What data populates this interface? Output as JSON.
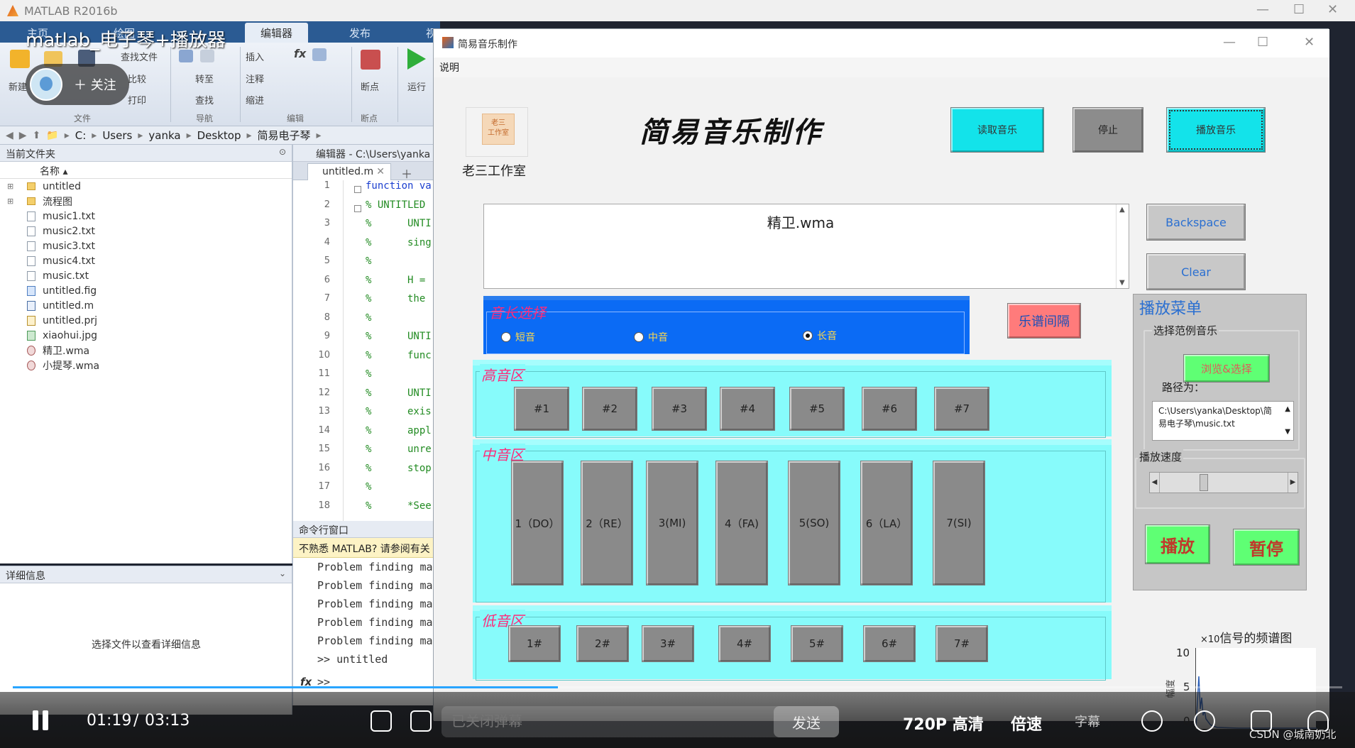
{
  "matlab": {
    "window_title": "MATLAB R2016b",
    "ribbon_tabs": [
      "主页",
      "绘图",
      "编辑器",
      "发布",
      "视"
    ],
    "ribbon": {
      "new": "新建",
      "open": "打开",
      "save": "保存",
      "find_files": "查找文件",
      "compare": "比较",
      "print": "打印",
      "goto": "转至",
      "find": "查找",
      "insert": "插入",
      "comment": "注释",
      "indent": "缩进",
      "breakpoints": "断点",
      "run": "运行",
      "groups": [
        "文件",
        "导航",
        "编辑",
        "断点"
      ]
    },
    "path": [
      "C:",
      "Users",
      "yanka",
      "Desktop",
      "简易电子琴"
    ],
    "current_folder": {
      "title": "当前文件夹",
      "name_col": "名称 ▴",
      "items": [
        {
          "name": "untitled",
          "type": "folder"
        },
        {
          "name": "流程图",
          "type": "folder"
        },
        {
          "name": "music1.txt",
          "type": "txt"
        },
        {
          "name": "music2.txt",
          "type": "txt"
        },
        {
          "name": "music3.txt",
          "type": "txt"
        },
        {
          "name": "music4.txt",
          "type": "txt"
        },
        {
          "name": "music.txt",
          "type": "txt"
        },
        {
          "name": "untitled.fig",
          "type": "fig"
        },
        {
          "name": "untitled.m",
          "type": "m"
        },
        {
          "name": "untitled.prj",
          "type": "prj"
        },
        {
          "name": "xiaohui.jpg",
          "type": "jpg"
        },
        {
          "name": "精卫.wma",
          "type": "wma"
        },
        {
          "name": "小提琴.wma",
          "type": "wma"
        }
      ]
    },
    "details": {
      "title": "详细信息",
      "hint": "选择文件以查看详细信息"
    },
    "editor": {
      "title": "编辑器 - C:\\Users\\yanka",
      "tab": "untitled.m",
      "lines": [
        {
          "n": "1",
          "t": "function va",
          "kw": true
        },
        {
          "n": "2",
          "t": "% UNTITLED"
        },
        {
          "n": "3",
          "t": "%      UNTI"
        },
        {
          "n": "4",
          "t": "%      sing"
        },
        {
          "n": "5",
          "t": "%"
        },
        {
          "n": "6",
          "t": "%      H ="
        },
        {
          "n": "7",
          "t": "%      the"
        },
        {
          "n": "8",
          "t": "%"
        },
        {
          "n": "9",
          "t": "%      UNTI"
        },
        {
          "n": "10",
          "t": "%      func"
        },
        {
          "n": "11",
          "t": "%"
        },
        {
          "n": "12",
          "t": "%      UNTI"
        },
        {
          "n": "13",
          "t": "%      exis"
        },
        {
          "n": "14",
          "t": "%      appl"
        },
        {
          "n": "15",
          "t": "%      unre"
        },
        {
          "n": "16",
          "t": "%      stop"
        },
        {
          "n": "17",
          "t": "%"
        },
        {
          "n": "18",
          "t": "%      *See"
        }
      ]
    },
    "command": {
      "title": "命令行窗口",
      "warning": "不熟悉 MATLAB? 请参阅有关",
      "lines": [
        "Problem finding ma",
        "Problem finding ma",
        "Problem finding ma",
        "Problem finding ma",
        "Problem finding ma",
        ">> untitled"
      ],
      "prompt": ">>"
    }
  },
  "figure": {
    "window_title": "简易音乐制作",
    "menu": "说明",
    "logo_text": "老三工作室",
    "logo_seal": "老三\n工作室",
    "title": "简易音乐制作",
    "buttons": {
      "read": "读取音乐",
      "stop": "停止",
      "play_music": "播放音乐",
      "backspace": "Backspace",
      "clear": "Clear",
      "interval": "乐谱间隔"
    },
    "display_text": "精卫.wma",
    "length_panel": {
      "title": "音长选择",
      "options": [
        "短音",
        "中音",
        "长音"
      ],
      "selected": 2
    },
    "high_zone": {
      "title": "高音区",
      "keys": [
        "#1",
        "#2",
        "#3",
        "#4",
        "#5",
        "#6",
        "#7"
      ]
    },
    "mid_zone": {
      "title": "中音区",
      "keys": [
        "1（DO）",
        "2（RE）",
        "3(MI)",
        "4（FA)",
        "5(SO)",
        "6（LA）",
        "7(SI)"
      ]
    },
    "low_zone": {
      "title": "低音区",
      "keys": [
        "1#",
        "2#",
        "3#",
        "4#",
        "5#",
        "6#",
        "7#"
      ]
    },
    "play_menu": {
      "title": "播放菜单",
      "select_title": "选择范例音乐",
      "browse": "浏览&选择",
      "path_label": "路径为：",
      "path": "C:\\Users\\yanka\\Desktop\\简易电子琴\\music.txt",
      "speed_title": "播放速度",
      "speed": 0.33,
      "play": "播放",
      "pause": "暂停"
    },
    "spectrum": {
      "title": "信号的频谱图",
      "exp": "×10",
      "yticks": [
        "10",
        "5",
        "0"
      ],
      "ylabel": "幅度"
    }
  },
  "video": {
    "title": "matlab_电子琴+播放器",
    "follow": "＋ 关注",
    "time_current": "01:19",
    "time_sep": "/",
    "time_total": "03:13",
    "progress": 0.41,
    "danmu_placeholder": "已关闭弹幕",
    "send": "发送",
    "quality": "720P 高清",
    "speed": "倍速",
    "subtitle": "字幕",
    "watermark": "CSDN @城南奶北"
  }
}
